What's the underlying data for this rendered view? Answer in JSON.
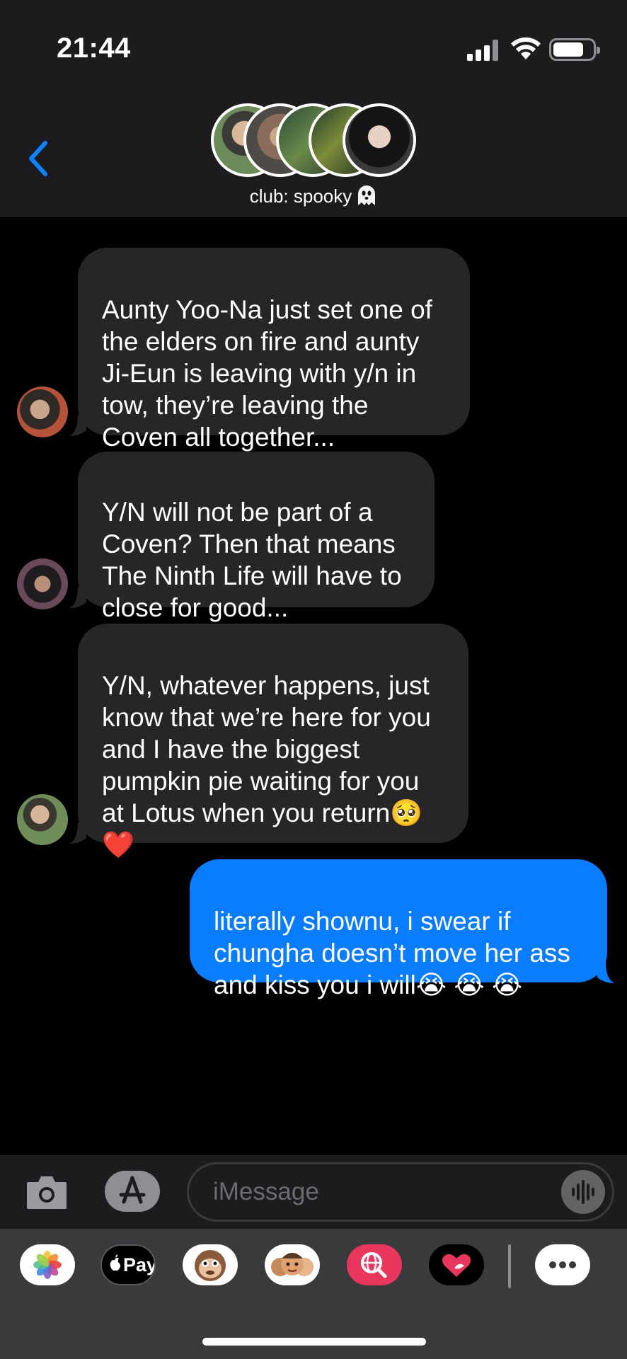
{
  "status_bar": {
    "time": "21:44",
    "signal_icon": "cellular-signal-icon",
    "wifi_icon": "wifi-icon",
    "battery_icon": "battery-icon"
  },
  "header": {
    "back_icon": "chevron-left-icon",
    "group_name": "club: spooky",
    "group_emoji_icon": "ghost-emoji-icon",
    "participant_avatars": 5
  },
  "messages": [
    {
      "direction": "incoming",
      "text": "Aunty Yoo-Na just set one of\nthe elders on fire and aunty\nJi-Eun is leaving with y/n in\ntow, they’re leaving the\nCoven all together..."
    },
    {
      "direction": "incoming",
      "text": "Y/N will not be part of a\nCoven? Then that means\nThe Ninth Life will have to\nclose for good..."
    },
    {
      "direction": "incoming",
      "text": "Y/N, whatever happens, just\nknow that we’re here for you\nand I have the biggest\npumpkin pie waiting for you\nat Lotus when you return🥺\n❤️"
    },
    {
      "direction": "outgoing",
      "text": "literally shownu, i swear if\nchungha doesn’t move her ass\nand kiss you i will😭 😭 😭"
    }
  ],
  "composer": {
    "camera_icon": "camera-icon",
    "apps_icon": "app-store-icon",
    "placeholder": "iMessage",
    "audio_icon": "audio-waveform-icon"
  },
  "app_drawer": {
    "apps": [
      {
        "name": "photos-app-icon"
      },
      {
        "name": "apple-pay-app-icon",
        "label": "Pay"
      },
      {
        "name": "animoji-app-icon"
      },
      {
        "name": "memoji-stickers-app-icon"
      },
      {
        "name": "web-images-app-icon"
      },
      {
        "name": "digital-touch-app-icon"
      },
      {
        "name": "more-apps-icon"
      }
    ]
  },
  "colors": {
    "incoming_bubble": "#262628",
    "outgoing_bubble": "#0a7cff",
    "accent": "#0a84ff",
    "background": "#000000"
  }
}
